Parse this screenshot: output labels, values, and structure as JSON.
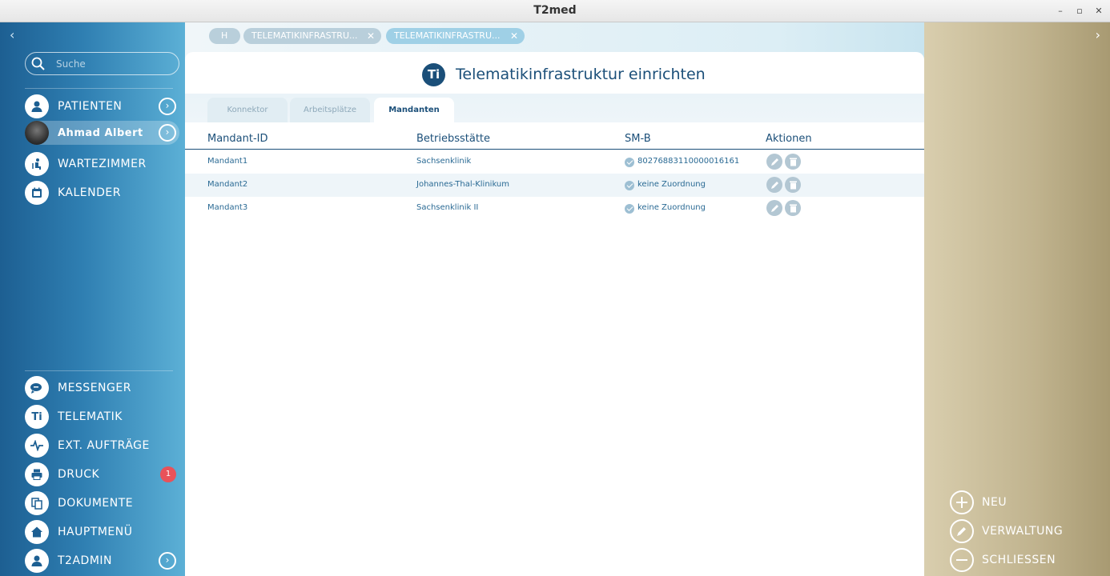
{
  "window": {
    "title": "T2med",
    "controls": [
      "–",
      "▫",
      "✕"
    ]
  },
  "sidebar": {
    "search_placeholder": "Suche",
    "top_items": [
      {
        "label": "PATIENTEN",
        "icon": "person-icon"
      },
      {
        "label": "Ahmad Albert",
        "icon": "avatar"
      },
      {
        "label": "WARTEZIMMER",
        "icon": "waiting-room-icon"
      },
      {
        "label": "KALENDER",
        "icon": "calendar-icon"
      }
    ],
    "bottom_items": [
      {
        "label": "MESSENGER",
        "icon": "chat-icon"
      },
      {
        "label": "TELEMATIK",
        "icon": "ti-icon",
        "icon_text": "Ti"
      },
      {
        "label": "EXT. AUFTRÄGE",
        "icon": "pulse-icon"
      },
      {
        "label": "DRUCK",
        "icon": "printer-icon",
        "badge": "1"
      },
      {
        "label": "DOKUMENTE",
        "icon": "documents-icon"
      },
      {
        "label": "HAUPTMENÜ",
        "icon": "home-icon"
      },
      {
        "label": "T2ADMIN",
        "icon": "admin-icon"
      }
    ]
  },
  "breadcrumb_tabs": [
    {
      "label": "H"
    },
    {
      "label": "TELEMATIKINFRASTRU...",
      "close": "✕"
    },
    {
      "label": "TELEMATIKINFRASTRU...",
      "close": "✕"
    }
  ],
  "page": {
    "icon_text": "Ti",
    "title": "Telematikinfrastruktur einrichten",
    "tabs": [
      "Konnektor",
      "Arbeitsplätze",
      "Mandanten"
    ],
    "active_tab": "Mandanten"
  },
  "table": {
    "columns": [
      "Mandant-ID",
      "Betriebsstätte",
      "SM-B",
      "Aktionen"
    ],
    "rows": [
      {
        "id": "Mandant1",
        "site": "Sachsenklinik",
        "smb": "80276883110000016161"
      },
      {
        "id": "Mandant2",
        "site": "Johannes-Thal-Klinikum",
        "smb": "keine Zuordnung"
      },
      {
        "id": "Mandant3",
        "site": "Sachsenklinik II",
        "smb": "keine Zuordnung"
      }
    ]
  },
  "right_actions": [
    {
      "label": "NEU",
      "icon": "plus-icon"
    },
    {
      "label": "VERWALTUNG",
      "icon": "pencil-icon"
    },
    {
      "label": "SCHLIESSEN",
      "icon": "minus-icon"
    }
  ],
  "colors": {
    "sidebar_dark": "#1d5f92",
    "sidebar_light": "#5cb0d6",
    "accent": "#1b4f79",
    "right_panel": "#c0b38e",
    "badge": "#e8525a"
  }
}
